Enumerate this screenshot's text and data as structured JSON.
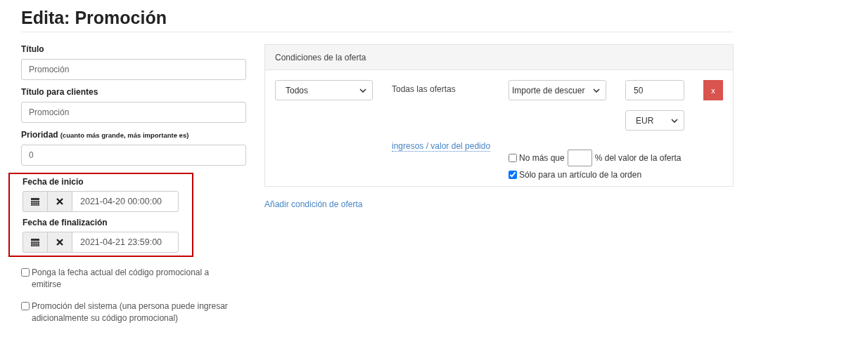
{
  "page_title": "Edita: Promoción",
  "fields": [
    {
      "label": "Título",
      "value": "Promoción"
    },
    {
      "label": "Título para clientes",
      "value": "Promoción"
    },
    {
      "label": "Prioridad",
      "hint": "(cuanto más grande, más importante es)",
      "value": "0"
    }
  ],
  "dates": {
    "highlighted": true,
    "fields": [
      {
        "label": "Fecha de inicio",
        "value": "2021-04-20 00:00:00"
      },
      {
        "label": "Fecha de finalización",
        "value": "2021-04-21 23:59:00"
      }
    ]
  },
  "options": [
    {
      "label": "Ponga la fecha actual del código promocional a emitirse",
      "checked": false
    },
    {
      "label": "Promoción del sistema (una persona puede ingresar adicionalmente su código promocional)",
      "checked": false
    }
  ],
  "conditions": {
    "title": "Condiciones de la oferta",
    "scope_select": "Todos",
    "offers_text": "Todas las ofertas",
    "type_select": "Importe de descuer",
    "amount": "50",
    "remove_button": "x",
    "currency_select": "EUR",
    "base_link": "ingresos / valor del pedido",
    "limit": {
      "checked": false,
      "before": "No más que",
      "after": "% del valor de la oferta"
    },
    "single_item": {
      "checked": true,
      "label": "Sólo para un artículo de la orden"
    }
  },
  "add_link": "Añadir condición de oferta"
}
